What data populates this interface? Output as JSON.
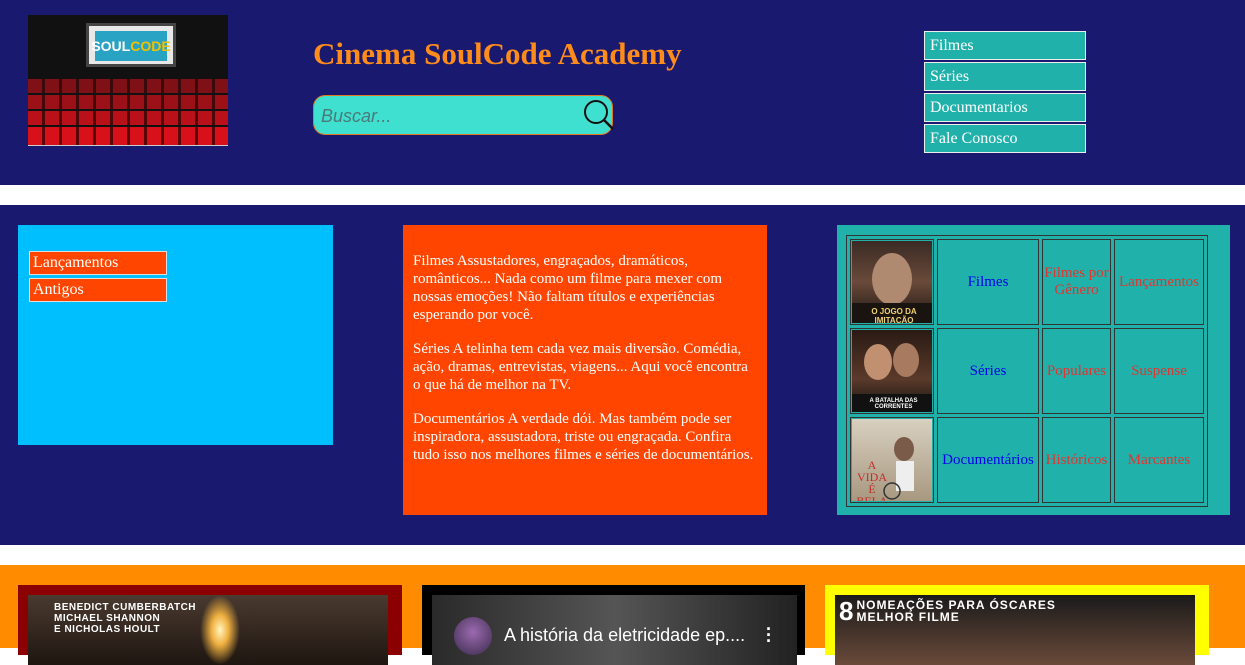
{
  "header": {
    "logo": {
      "text_soul": "SOUL",
      "text_code": "CODE"
    },
    "title": "Cinema SoulCode Academy",
    "search_placeholder": "Buscar...",
    "nav": [
      "Filmes",
      "Séries",
      "Documentarios",
      "Fale Conosco"
    ]
  },
  "sidebar": {
    "links": [
      "Lançamentos",
      "Antigos"
    ]
  },
  "content": {
    "paragraphs": [
      "Filmes Assustadores, engraçados, dramáticos, românticos... Nada como um filme para mexer com nossas emoções! Não faltam títulos e experiências esperando por você.",
      "Séries A telinha tem cada vez mais diversão. Comédia, ação, dramas, entrevistas, viagens... Aqui você encontra o que há de melhor na TV.",
      "Documentários A verdade dói. Mas também pode ser inspiradora, assustadora, triste ou engraçada. Confira tudo isso nos melhores filmes e séries de documentários."
    ]
  },
  "table": {
    "rows": [
      {
        "category": "Filmes",
        "genre": "Filmes por Gênero",
        "sub": "Lançamentos",
        "poster_text": "O JOGO DA IMITAÇÃO"
      },
      {
        "category": "Séries",
        "genre": "Populares",
        "sub": "Suspense",
        "poster_text": "A BATALHA DAS CORRENTES"
      },
      {
        "category": "Documentários",
        "genre": "Históricos",
        "sub": "Marcantes",
        "poster_text": "A VIDA É BELA"
      }
    ]
  },
  "bottom": {
    "card1_credits": [
      "BENEDICT CUMBERBATCH",
      "MICHAEL SHANNON",
      "E NICHOLAS HOULT"
    ],
    "video_title": "A história da eletricidade ep....",
    "card3_badge_num": "8",
    "card3_badge_lines": [
      "NOMEAÇÕES PARA ÓSCARES",
      "MELHOR FILME"
    ]
  },
  "colors": {
    "header_bg": "#191970",
    "title": "#ff8c1a",
    "nav_bg": "#20b2aa",
    "search_bg": "#40e0d0",
    "sidebar_bg": "#00bfff",
    "text_box_bg": "#ff4500",
    "bottom_bg": "#ff8c00"
  }
}
